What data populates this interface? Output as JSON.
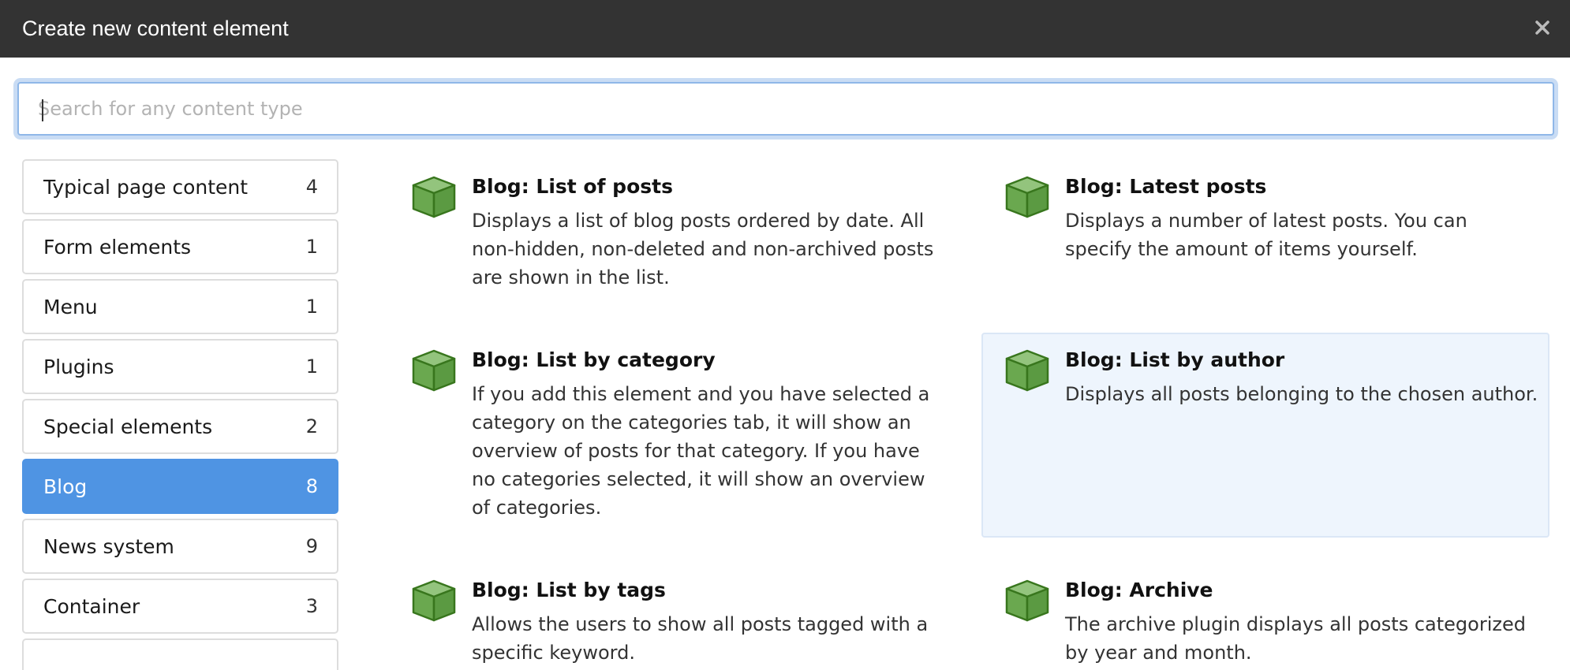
{
  "dialog": {
    "title": "Create new content element",
    "close_label": "×"
  },
  "search": {
    "placeholder": "Search for any content type",
    "value": ""
  },
  "colors": {
    "titlebar": "#333333",
    "active_category": "#4f94e3",
    "hover_card": "#eef5fd",
    "cube_green": "#6aa84f"
  },
  "categories": [
    {
      "label": "Typical page content",
      "count": "4",
      "active": false
    },
    {
      "label": "Form elements",
      "count": "1",
      "active": false
    },
    {
      "label": "Menu",
      "count": "1",
      "active": false
    },
    {
      "label": "Plugins",
      "count": "1",
      "active": false
    },
    {
      "label": "Special elements",
      "count": "2",
      "active": false
    },
    {
      "label": "Blog",
      "count": "8",
      "active": true
    },
    {
      "label": "News system",
      "count": "9",
      "active": false
    },
    {
      "label": "Container",
      "count": "3",
      "active": false
    }
  ],
  "elements": [
    {
      "title": "Blog: List of posts",
      "description": "Displays a list of blog posts ordered by date. All non-hidden, non-deleted and non-archived posts are shown in the list.",
      "icon": "cube-icon"
    },
    {
      "title": "Blog: Latest posts",
      "description": "Displays a number of latest posts. You can specify the amount of items yourself.",
      "icon": "cube-icon"
    },
    {
      "title": "Blog: List by category",
      "description": "If you add this element and you have selected a category on the categories tab, it will show an overview of posts for that category. If you have no categories selected, it will show an overview of categories.",
      "icon": "cube-icon"
    },
    {
      "title": "Blog: List by author",
      "description": "Displays all posts belonging to the chosen author.",
      "icon": "cube-icon",
      "hovered": true
    },
    {
      "title": "Blog: List by tags",
      "description": "Allows the users to show all posts tagged with a specific keyword.",
      "icon": "cube-icon"
    },
    {
      "title": "Blog: Archive",
      "description": "The archive plugin displays all posts categorized by year and month.",
      "icon": "cube-icon"
    }
  ]
}
